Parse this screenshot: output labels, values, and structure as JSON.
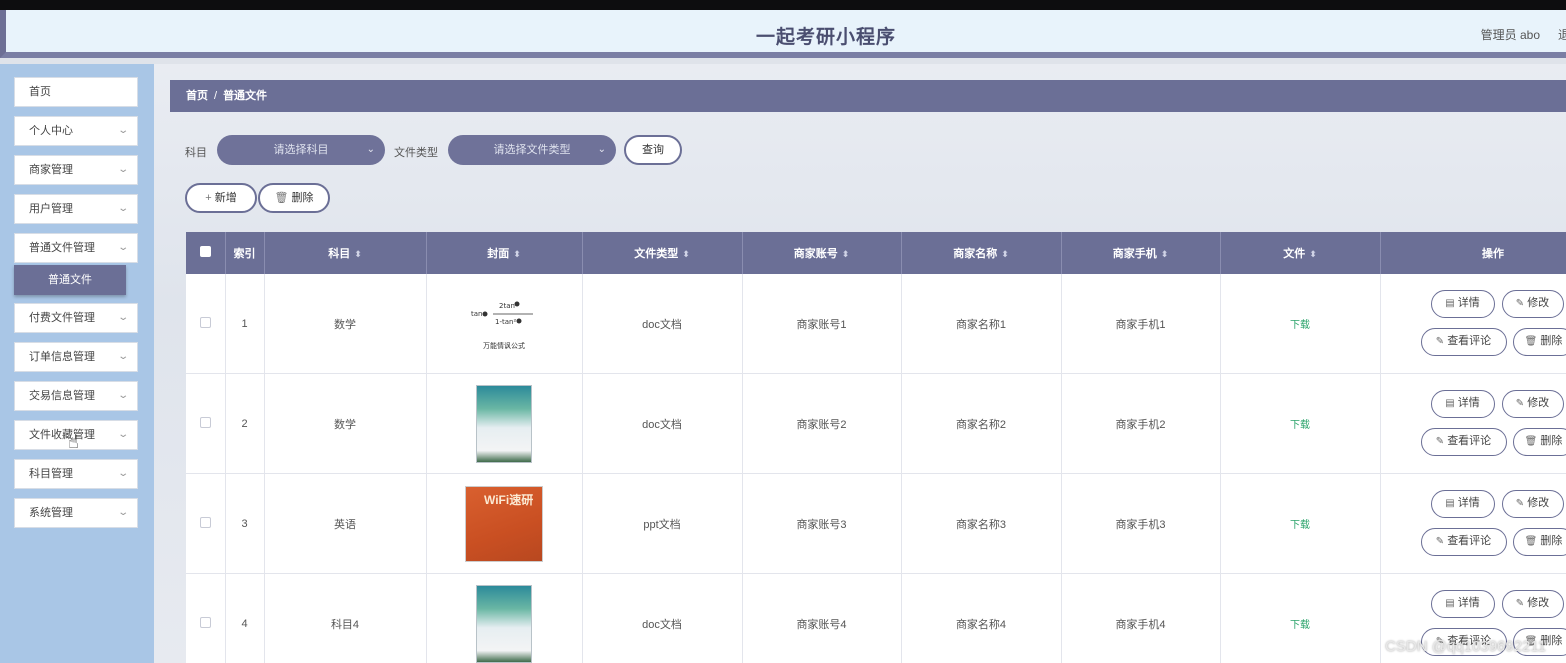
{
  "header": {
    "title": "一起考研小程序",
    "admin": "管理员 abo",
    "logout": "退"
  },
  "sidebar": {
    "items": [
      {
        "label": "首页",
        "chevron": false
      },
      {
        "label": "个人中心",
        "chevron": true
      },
      {
        "label": "商家管理",
        "chevron": true
      },
      {
        "label": "用户管理",
        "chevron": true
      },
      {
        "label": "普通文件管理",
        "chevron": true
      },
      {
        "label": "付费文件管理",
        "chevron": true
      },
      {
        "label": "订单信息管理",
        "chevron": true
      },
      {
        "label": "交易信息管理",
        "chevron": true
      },
      {
        "label": "文件收藏管理",
        "chevron": true
      },
      {
        "label": "科目管理",
        "chevron": true
      },
      {
        "label": "系统管理",
        "chevron": true
      }
    ],
    "active_sub": "普通文件"
  },
  "breadcrumb": {
    "home": "首页",
    "sep": "/",
    "current": "普通文件"
  },
  "filters": {
    "subject_label": "科目",
    "subject_placeholder": "请选择科目",
    "type_label": "文件类型",
    "type_placeholder": "请选择文件类型",
    "search_button": "查询"
  },
  "actions": {
    "add": "新增",
    "delete": "删除"
  },
  "table": {
    "columns": [
      "索引",
      "科目",
      "封面",
      "文件类型",
      "商家账号",
      "商家名称",
      "商家手机",
      "文件",
      "操作"
    ],
    "rows": [
      {
        "index": "1",
        "subject": "数学",
        "cover": "formula",
        "cover_caption": "万能情讽公式",
        "type": "doc文档",
        "account": "商家账号1",
        "name": "商家名称1",
        "phone": "商家手机1",
        "file": "下载"
      },
      {
        "index": "2",
        "subject": "数学",
        "cover": "book",
        "type": "doc文档",
        "account": "商家账号2",
        "name": "商家名称2",
        "phone": "商家手机2",
        "file": "下载"
      },
      {
        "index": "3",
        "subject": "英语",
        "cover": "wifi",
        "cover_caption": "WiFi速研",
        "type": "ppt文档",
        "account": "商家账号3",
        "name": "商家名称3",
        "phone": "商家手机3",
        "file": "下载"
      },
      {
        "index": "4",
        "subject": "科目4",
        "cover": "book",
        "type": "doc文档",
        "account": "商家账号4",
        "name": "商家名称4",
        "phone": "商家手机4",
        "file": "下载"
      }
    ],
    "row_actions": {
      "detail": "详情",
      "edit": "修改",
      "comments": "查看评论",
      "delete": "删除"
    }
  },
  "watermark": "CSDN @qq1039692211",
  "colors": {
    "accent": "#6b6f96",
    "sidebar": "#a9c6e6",
    "download": "#29a36a"
  }
}
